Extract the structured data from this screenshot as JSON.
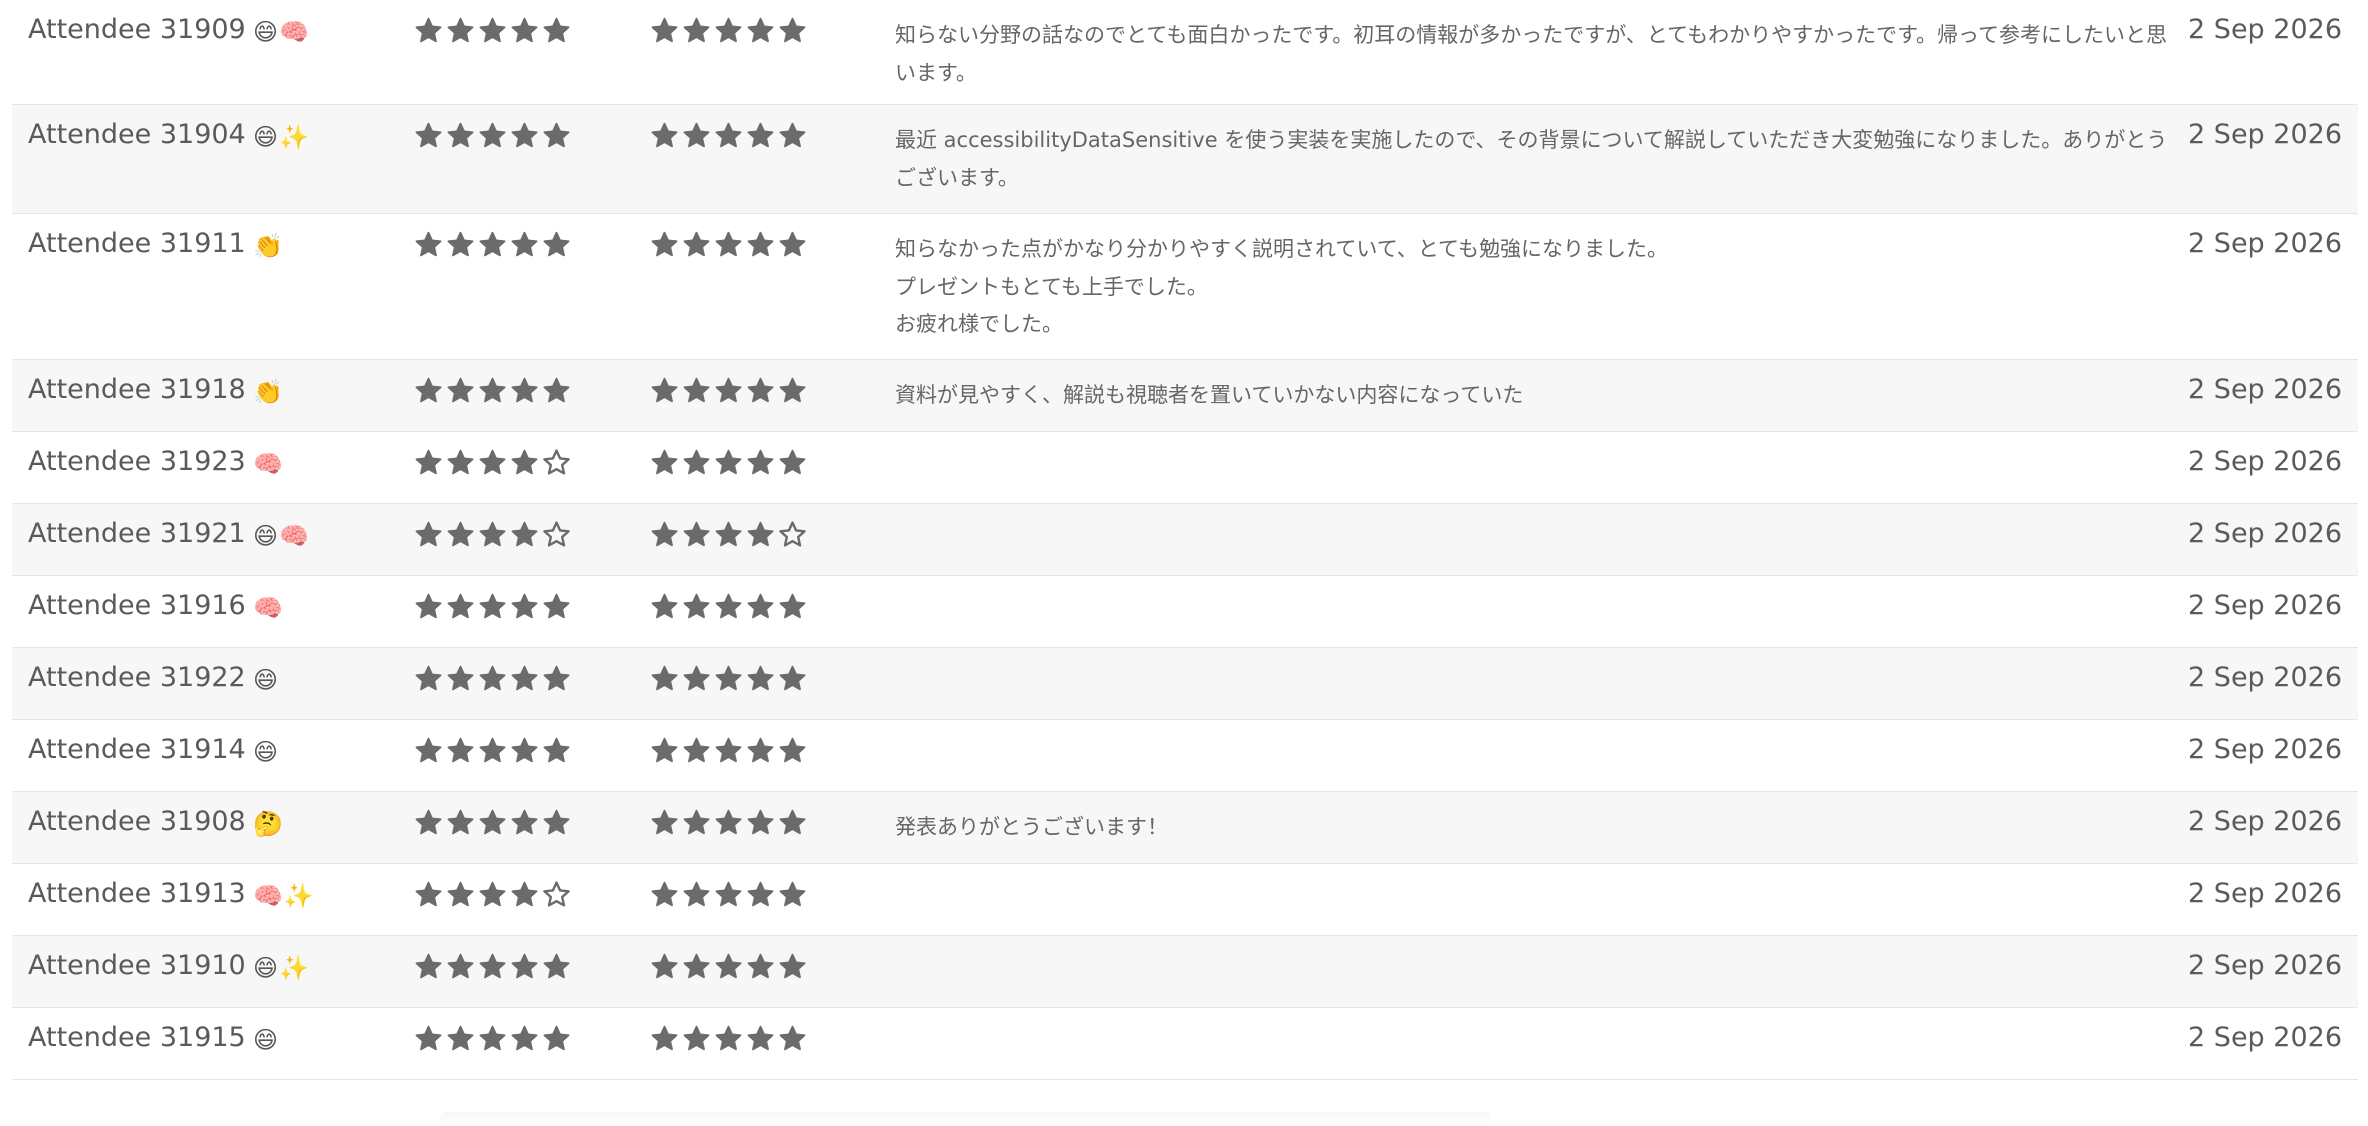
{
  "rows": [
    {
      "name": "Attendee 31909",
      "reaction": "😄🧠",
      "rating1": 5,
      "rating2": 5,
      "comment": "知らない分野の話なのでとても面白かったです。初耳の情報が多かったですが、とてもわかりやすかったです。帰って参考にしたいと思います。",
      "date": "2 Sep 2026"
    },
    {
      "name": "Attendee 31904",
      "reaction": "😄✨",
      "rating1": 5,
      "rating2": 5,
      "comment": "最近 accessibilityDataSensitive を使う実装を実施したので、その背景について解説していただき大変勉強になりました。ありがとうございます。",
      "date": "2 Sep 2026"
    },
    {
      "name": "Attendee 31911",
      "reaction": "👏",
      "rating1": 5,
      "rating2": 5,
      "comment": "知らなかった点がかなり分かりやすく説明されていて、とても勉強になりました。\nプレゼントもとても上手でした。\nお疲れ様でした。",
      "date": "2 Sep 2026"
    },
    {
      "name": "Attendee 31918",
      "reaction": "👏",
      "rating1": 5,
      "rating2": 5,
      "comment": "資料が見やすく、解説も視聴者を置いていかない内容になっていた",
      "date": "2 Sep 2026"
    },
    {
      "name": "Attendee 31923",
      "reaction": "🧠",
      "rating1": 4,
      "rating2": 5,
      "comment": "",
      "date": "2 Sep 2026"
    },
    {
      "name": "Attendee 31921",
      "reaction": "😄🧠",
      "rating1": 4,
      "rating2": 4,
      "comment": "",
      "date": "2 Sep 2026"
    },
    {
      "name": "Attendee 31916",
      "reaction": "🧠",
      "rating1": 5,
      "rating2": 5,
      "comment": "",
      "date": "2 Sep 2026"
    },
    {
      "name": "Attendee 31922",
      "reaction": "😄",
      "rating1": 5,
      "rating2": 5,
      "comment": "",
      "date": "2 Sep 2026"
    },
    {
      "name": "Attendee 31914",
      "reaction": "😄",
      "rating1": 5,
      "rating2": 5,
      "comment": "",
      "date": "2 Sep 2026"
    },
    {
      "name": "Attendee 31908",
      "reaction": "🤔",
      "rating1": 5,
      "rating2": 5,
      "comment": "発表ありがとうございます！",
      "date": "2 Sep 2026"
    },
    {
      "name": "Attendee 31913",
      "reaction": "🧠✨",
      "rating1": 4,
      "rating2": 5,
      "comment": "",
      "date": "2 Sep 2026"
    },
    {
      "name": "Attendee 31910",
      "reaction": "😄✨",
      "rating1": 5,
      "rating2": 5,
      "comment": "",
      "date": "2 Sep 2026"
    },
    {
      "name": "Attendee 31915",
      "reaction": "😄",
      "rating1": 5,
      "rating2": 5,
      "comment": "",
      "date": "2 Sep 2026"
    }
  ],
  "star_max": 5,
  "colors": {
    "star": "#6b6b6b",
    "alt_row": "#f7f7f7",
    "border": "#e6e6e6",
    "text": "#5a5a5a"
  }
}
